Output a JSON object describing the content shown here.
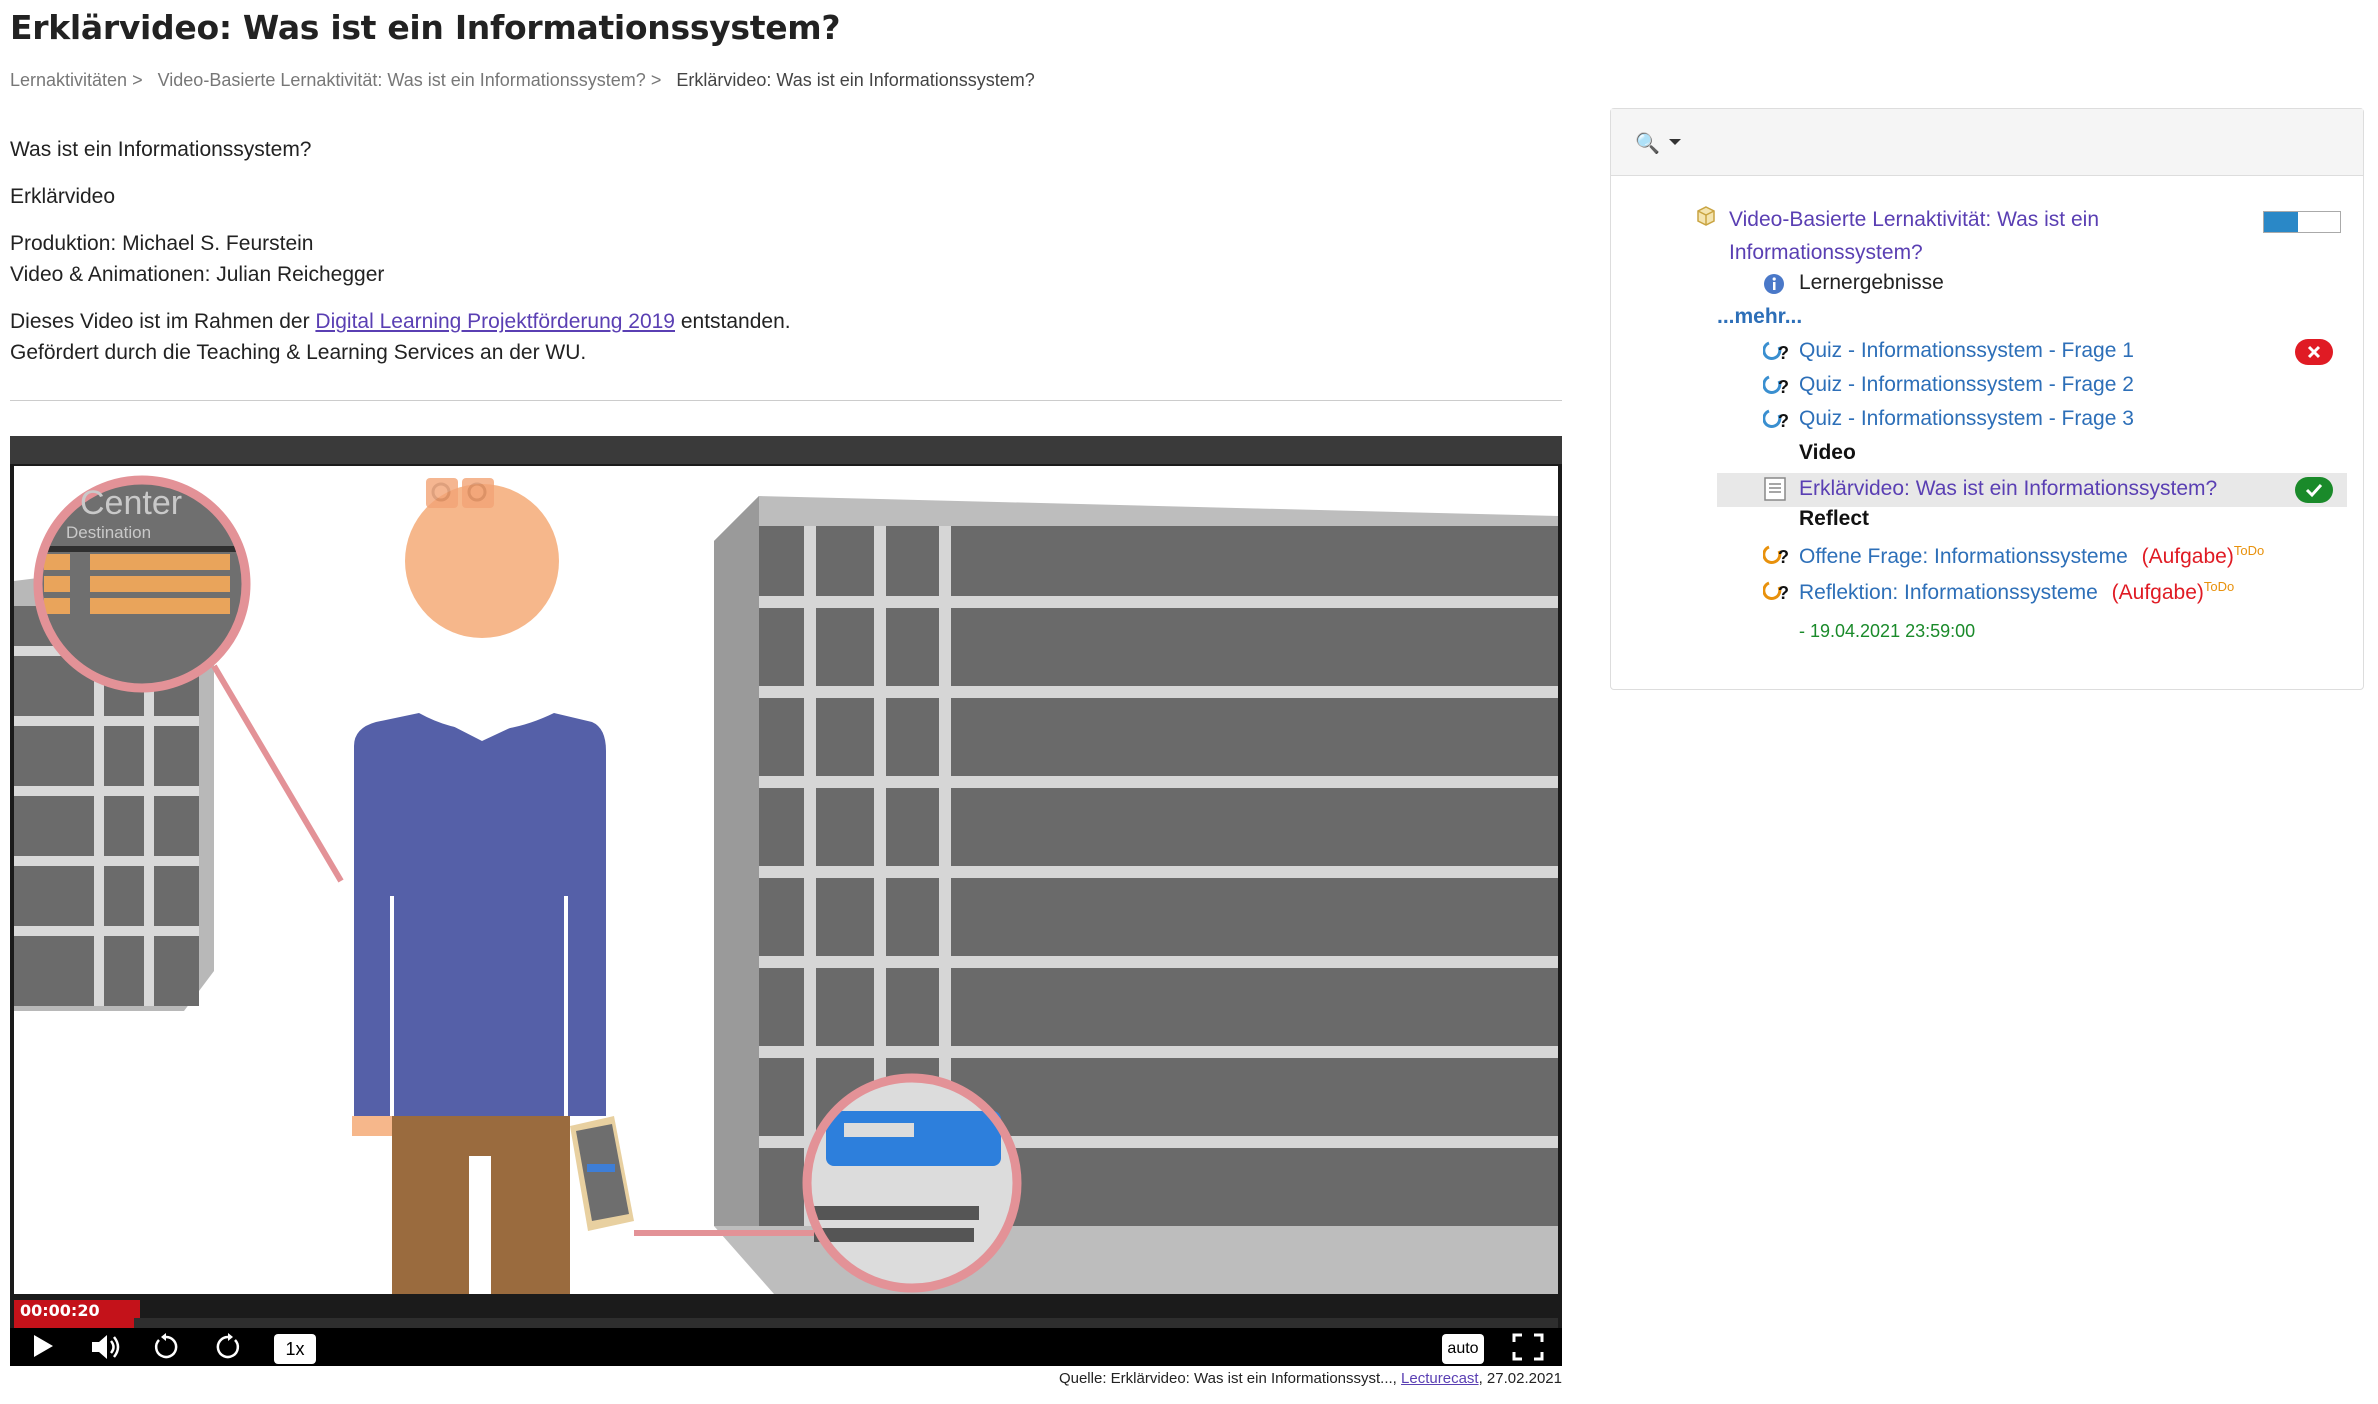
{
  "page": {
    "title": "Erklärvideo: Was ist ein Informationssystem?"
  },
  "breadcrumb": {
    "items": [
      "Lernaktivitäten >",
      "Video-Basierte Lernaktivität: Was ist ein Informationssystem? >"
    ],
    "current": "Erklärvideo: Was ist ein Informationssystem?"
  },
  "content": {
    "line1": "Was ist ein Informationssystem?",
    "line2": "Erklärvideo",
    "line3": "Produktion: Michael S. Feurstein",
    "line4": "Video & Animationen: Julian Reichegger",
    "line5_before": "Dieses Video ist im Rahmen der",
    "line5_link": "Digital Learning Projektförderung 2019",
    "line5_after": "entstanden.",
    "line6": "Gefördert durch die Teaching & Learning Services an der WU."
  },
  "video": {
    "timecode": "00:00:20",
    "progress_fraction": 0.078,
    "speed": "1x",
    "quality": "auto",
    "scene_text": {
      "center": "Center",
      "destination": "Destination"
    }
  },
  "source": {
    "prefix": "Quelle: Erklärvideo: Was ist ein Informationssyst...,",
    "link": "Lecturecast",
    "date": ", 27.02.2021"
  },
  "panel": {
    "root_title_line1": "Video-Basierte Lernaktivität: Was ist ein",
    "root_title_line2": "Informationssystem?",
    "lernergebnisse": "Lernergebnisse",
    "mehr": "...mehr...",
    "quiz": [
      "Quiz - Informationssystem - Frage 1",
      "Quiz - Informationssystem - Frage 2",
      "Quiz - Informationssystem - Frage 3"
    ],
    "section_video": "Video",
    "video_item": "Erklärvideo: Was ist ein Informationssystem?",
    "section_reflect": "Reflect",
    "reflect_items": [
      {
        "label": "Offene Frage: Informationssysteme",
        "tag": "(Aufgabe)",
        "sup": "ToDo"
      },
      {
        "label": "Reflektion: Informationssysteme",
        "tag": "(Aufgabe)",
        "sup": "ToDo"
      }
    ],
    "deadline": "- 19.04.2021 23:59:00",
    "colors": {
      "fail": "#e01b24",
      "ok": "#1a8a2a",
      "todo": "#e8910c",
      "aufgabe": "#e01b24"
    }
  }
}
